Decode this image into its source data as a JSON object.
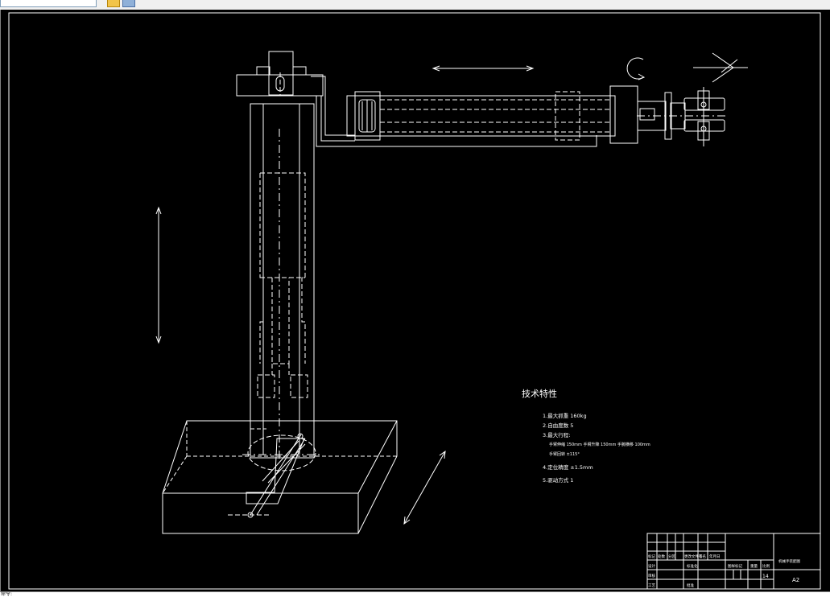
{
  "window": {
    "command_prompt": "命令:"
  },
  "drawing": {
    "tech_title": "技术特性",
    "specs": [
      "1.最大抓重 160kg",
      "2.自由度数 5",
      "3.最大行程:",
      "手臂伸缩 150mm 手臂升降 150mm 手腕横移 100mm",
      "手臂回转 ±115°",
      "4.定位精度 ±1.5mm",
      "5.驱动方式 1"
    ],
    "title_block": {
      "drawing_name": "机械手装配图",
      "sheet_count": "14",
      "sheet_size": "A2",
      "label_stage": "图样标记",
      "label_weight": "重量",
      "label_ratio": "比例",
      "rev_headers": [
        "标记",
        "处数",
        "分区",
        "更改文件号",
        "签名",
        "年月日"
      ],
      "row_labels": [
        "设计",
        "审核",
        "工艺"
      ],
      "mid_labels": [
        "标准化",
        "批准"
      ]
    }
  }
}
